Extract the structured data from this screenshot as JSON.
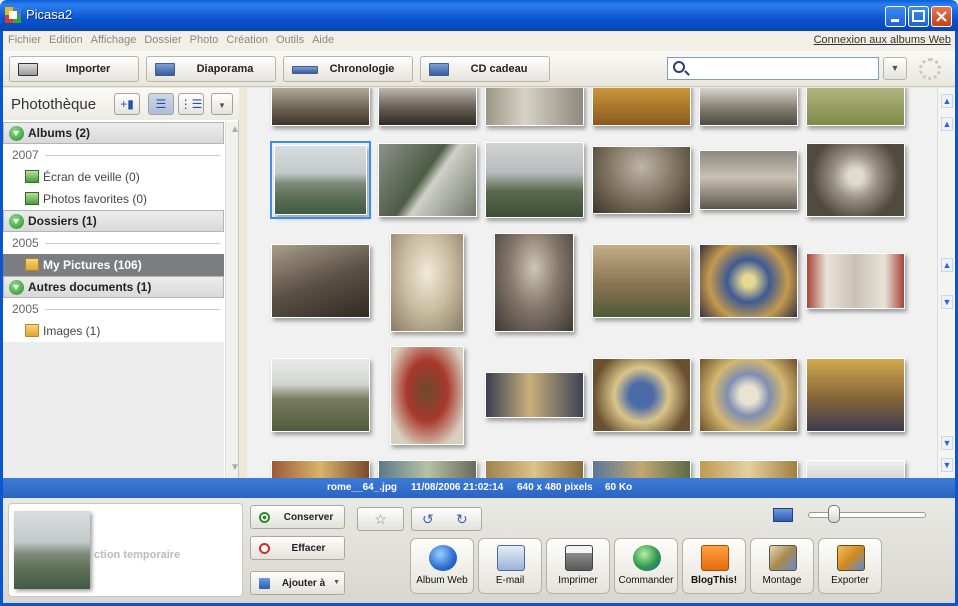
{
  "window": {
    "title": "Picasa2"
  },
  "menu": {
    "items": [
      "Fichier",
      "Edition",
      "Affichage",
      "Dossier",
      "Photo",
      "Création",
      "Outils",
      "Aide"
    ],
    "web_link": "Connexion aux albums Web"
  },
  "toolbar": {
    "import": "Importer",
    "slideshow": "Diaporama",
    "timeline": "Chronologie",
    "gift_cd": "CD cadeau",
    "search_value": ""
  },
  "library": {
    "title": "Photothèque",
    "albums_header": "Albums (2)",
    "albums_year": "2007",
    "albums": [
      "Écran de veille (0)",
      "Photos favorites (0)"
    ],
    "folders_header": "Dossiers (1)",
    "folders_year": "2005",
    "folders": [
      "My Pictures (106)"
    ],
    "other_header": "Autres documents (1)",
    "other_year": "2005",
    "other": [
      "Images (1)"
    ]
  },
  "status": {
    "filename": "rome__64_.jpg",
    "datetime": "11/08/2006 21:02:14",
    "dimensions": "640 x 480 pixels",
    "size": "60 Ko"
  },
  "tray": {
    "holding_text": "ction temporaire",
    "keep": "Conserver",
    "clear": "Effacer",
    "add_to": "Ajouter à"
  },
  "actions": {
    "web_album": "Album Web",
    "email": "E-mail",
    "print": "Imprimer",
    "order": "Commander",
    "blog": "BlogThis!",
    "montage": "Montage",
    "export": "Exporter"
  }
}
